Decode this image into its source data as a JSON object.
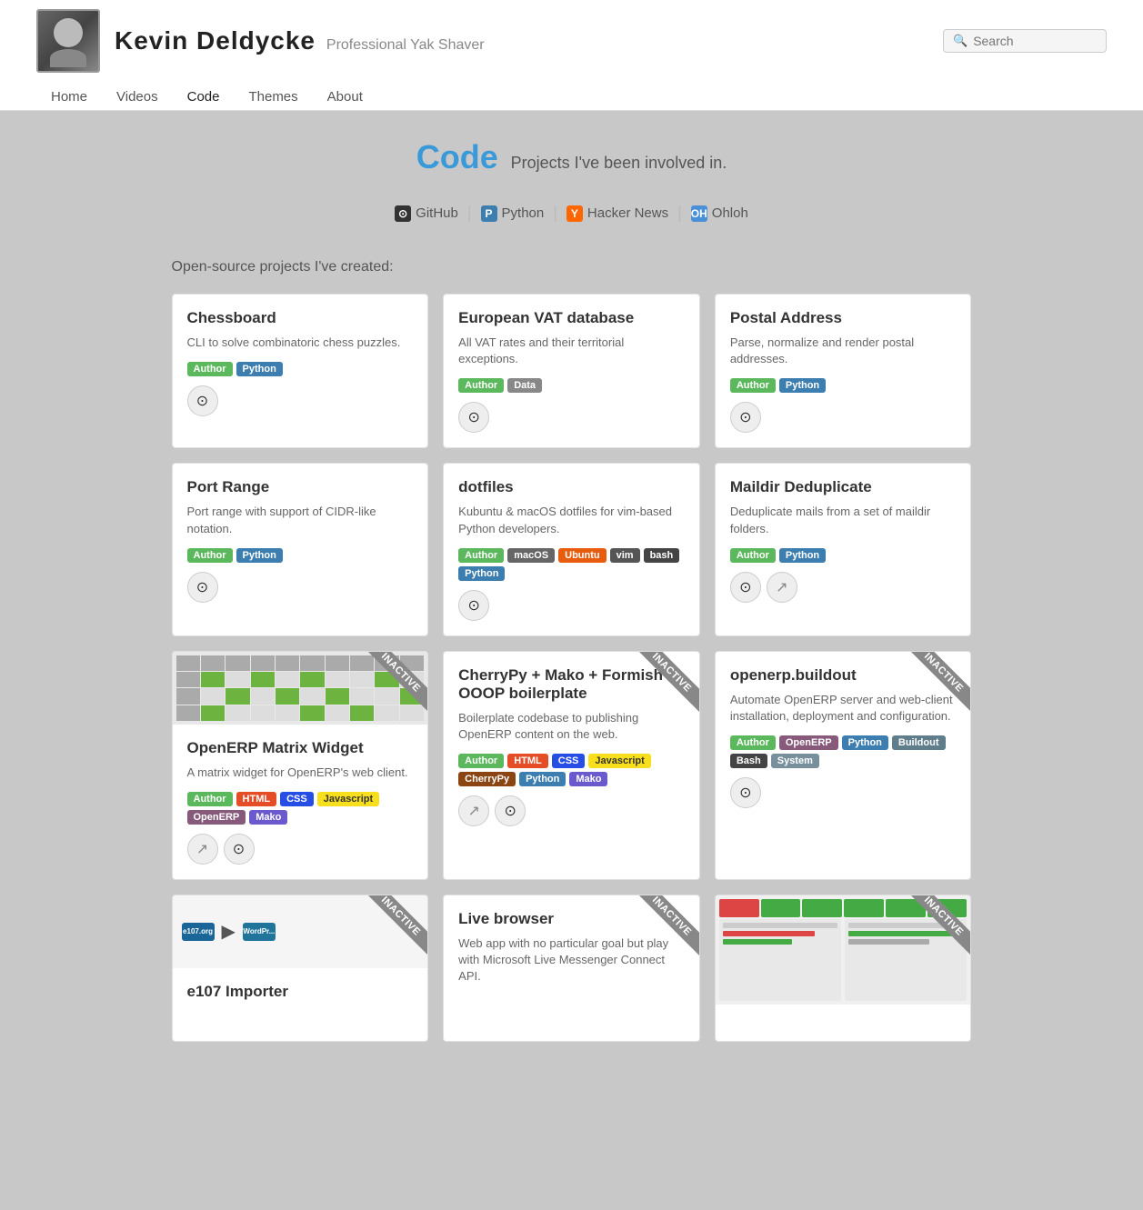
{
  "header": {
    "name": "Kevin Deldycke",
    "tagline": "Professional Yak Shaver",
    "nav": [
      {
        "label": "Home",
        "active": false
      },
      {
        "label": "Videos",
        "active": false
      },
      {
        "label": "Code",
        "active": true
      },
      {
        "label": "Themes",
        "active": false
      },
      {
        "label": "About",
        "active": false
      }
    ],
    "search_placeholder": "Search"
  },
  "page": {
    "title_code": "Code",
    "subtitle": "Projects I've been involved in."
  },
  "links": [
    {
      "label": "GitHub",
      "icon": "github",
      "icon_label": "G"
    },
    {
      "label": "Python",
      "icon": "python",
      "icon_label": "P"
    },
    {
      "label": "Hacker News",
      "icon": "hn",
      "icon_label": "Y"
    },
    {
      "label": "Ohloh",
      "icon": "oh",
      "icon_label": "OH"
    }
  ],
  "section_heading": "Open-source projects I've created:",
  "projects": [
    {
      "id": "chessboard",
      "title": "Chessboard",
      "desc": "CLI to solve combinatoric chess puzzles.",
      "tags": [
        {
          "label": "Author",
          "class": "tag-author"
        },
        {
          "label": "Python",
          "class": "tag-python"
        }
      ],
      "icons": [
        "github"
      ],
      "inactive": false,
      "thumb": false
    },
    {
      "id": "european-vat-database",
      "title": "European VAT database",
      "desc": "All VAT rates and their territorial exceptions.",
      "tags": [
        {
          "label": "Author",
          "class": "tag-author"
        },
        {
          "label": "Data",
          "class": "tag-data"
        }
      ],
      "icons": [
        "github"
      ],
      "inactive": false,
      "thumb": false
    },
    {
      "id": "postal-address",
      "title": "Postal Address",
      "desc": "Parse, normalize and render postal addresses.",
      "tags": [
        {
          "label": "Author",
          "class": "tag-author"
        },
        {
          "label": "Python",
          "class": "tag-python"
        }
      ],
      "icons": [
        "github"
      ],
      "inactive": false,
      "thumb": false
    },
    {
      "id": "port-range",
      "title": "Port Range",
      "desc": "Port range with support of CIDR-like notation.",
      "tags": [
        {
          "label": "Author",
          "class": "tag-author"
        },
        {
          "label": "Python",
          "class": "tag-python"
        }
      ],
      "icons": [
        "github"
      ],
      "inactive": false,
      "thumb": false
    },
    {
      "id": "dotfiles",
      "title": "dotfiles",
      "desc": "Kubuntu & macOS dotfiles for vim-based Python developers.",
      "tags": [
        {
          "label": "Author",
          "class": "tag-author"
        },
        {
          "label": "macOS",
          "class": "tag-macos"
        },
        {
          "label": "Ubuntu",
          "class": "tag-ubuntu"
        },
        {
          "label": "vim",
          "class": "tag-vim"
        },
        {
          "label": "bash",
          "class": "tag-bash"
        },
        {
          "label": "Python",
          "class": "tag-python"
        }
      ],
      "icons": [
        "github"
      ],
      "inactive": false,
      "thumb": false
    },
    {
      "id": "maildir-deduplicate",
      "title": "Maildir Deduplicate",
      "desc": "Deduplicate mails from a set of maildir folders.",
      "tags": [
        {
          "label": "Author",
          "class": "tag-author"
        },
        {
          "label": "Python",
          "class": "tag-python"
        }
      ],
      "icons": [
        "github",
        "share"
      ],
      "inactive": false,
      "thumb": false
    },
    {
      "id": "openerp-matrix-widget",
      "title": "OpenERP Matrix Widget",
      "desc": "A matrix widget for OpenERP's web client.",
      "tags": [
        {
          "label": "Author",
          "class": "tag-author"
        },
        {
          "label": "HTML",
          "class": "tag-html"
        },
        {
          "label": "CSS",
          "class": "tag-css"
        },
        {
          "label": "Javascript",
          "class": "tag-javascript"
        },
        {
          "label": "OpenERP",
          "class": "tag-openerp"
        },
        {
          "label": "Mako",
          "class": "tag-mako"
        }
      ],
      "icons": [
        "share",
        "github"
      ],
      "inactive": true,
      "thumb": "matrix"
    },
    {
      "id": "cherrypy-boilerplate",
      "title": "CherryPy + Mako + Formish + OOOP boilerplate",
      "desc": "Boilerplate codebase to publishing OpenERP content on the web.",
      "tags": [
        {
          "label": "Author",
          "class": "tag-author"
        },
        {
          "label": "HTML",
          "class": "tag-html"
        },
        {
          "label": "CSS",
          "class": "tag-css"
        },
        {
          "label": "Javascript",
          "class": "tag-javascript"
        },
        {
          "label": "CherryPy",
          "class": "tag-cherrypy"
        },
        {
          "label": "Python",
          "class": "tag-python"
        },
        {
          "label": "Mako",
          "class": "tag-mako"
        }
      ],
      "icons": [
        "share",
        "github"
      ],
      "inactive": true,
      "thumb": false
    },
    {
      "id": "openerp-buildout",
      "title": "openerp.buildout",
      "desc": "Automate OpenERP server and web-client installation, deployment and configuration.",
      "tags": [
        {
          "label": "Author",
          "class": "tag-author"
        },
        {
          "label": "OpenERP",
          "class": "tag-openerp"
        },
        {
          "label": "Python",
          "class": "tag-python"
        },
        {
          "label": "Buildout",
          "class": "tag-buildout"
        },
        {
          "label": "Bash",
          "class": "tag-bash"
        },
        {
          "label": "System",
          "class": "tag-system"
        }
      ],
      "icons": [
        "github"
      ],
      "inactive": true,
      "thumb": false
    },
    {
      "id": "e107-importer",
      "title": "e107 Importer",
      "desc": "",
      "tags": [],
      "icons": [],
      "inactive": true,
      "thumb": "e107"
    },
    {
      "id": "live-browser",
      "title": "Live browser",
      "desc": "Web app with no particular goal but play with Microsoft Live Messenger Connect API.",
      "tags": [],
      "icons": [],
      "inactive": true,
      "thumb": false
    },
    {
      "id": "mailpng-dashboard",
      "title": "",
      "desc": "",
      "tags": [],
      "icons": [],
      "inactive": true,
      "thumb": "mailpng"
    }
  ]
}
